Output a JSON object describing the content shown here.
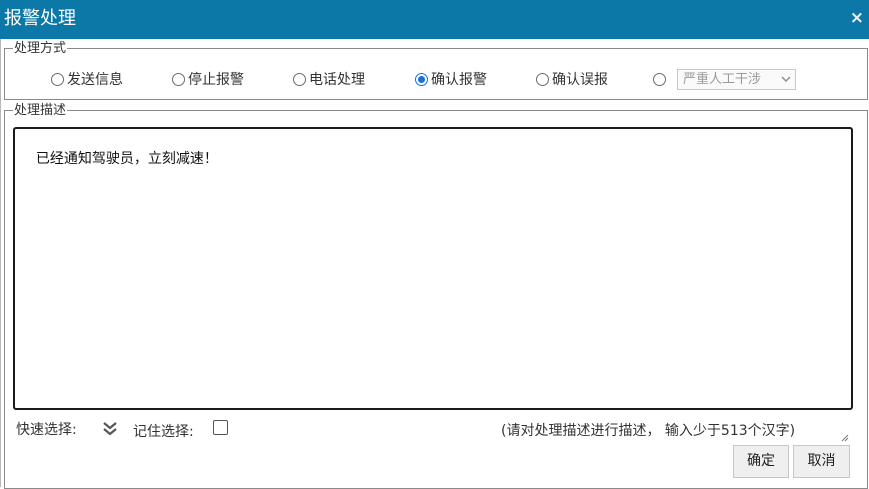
{
  "window": {
    "title": "报警处理",
    "close_glyph": "×",
    "title_bar_color": "#0b78a8"
  },
  "method_group": {
    "legend": "处理方式",
    "options": [
      {
        "label": "发送信息",
        "checked": false
      },
      {
        "label": "停止报警",
        "checked": false
      },
      {
        "label": "电话处理",
        "checked": false
      },
      {
        "label": "确认报警",
        "checked": true
      },
      {
        "label": "确认误报",
        "checked": false
      },
      {
        "label": "",
        "checked": false
      }
    ],
    "select_value": "严重人工干涉",
    "select_disabled": true
  },
  "description_group": {
    "legend": "处理描述",
    "text": "已经通知驾驶员，立刻减速！"
  },
  "footer": {
    "quick_select_label": "快速选择:",
    "quick_select_icon": "double-chevron-down-icon",
    "remember_label": "记住选择:",
    "remember_checked": false,
    "hint": "(请对处理描述进行描述， 输入少于513个汉字)"
  },
  "buttons": {
    "ok_label": "确定",
    "cancel_label": "取消"
  },
  "colors": {
    "radio_checked": "#1a6fd8"
  }
}
